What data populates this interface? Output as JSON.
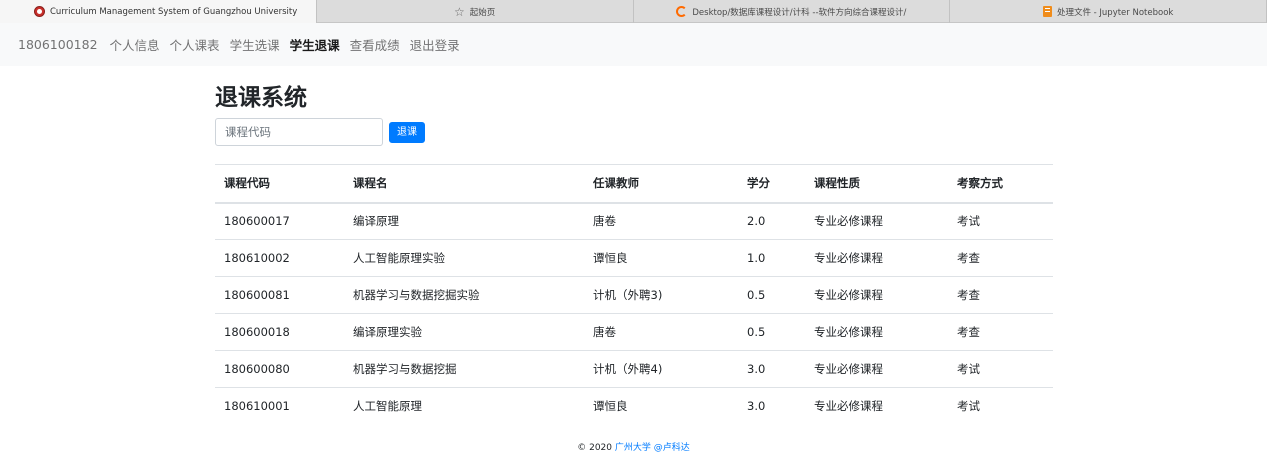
{
  "browser": {
    "tabs": [
      {
        "title": "Curriculum Management System of Guangzhou University",
        "icon": "gzhu-logo-icon",
        "active": true
      },
      {
        "title": "起始页",
        "icon": "star-icon",
        "active": false
      },
      {
        "title": "Desktop/数据库课程设计/计科 --软件方向综合课程设计/",
        "icon": "jupyter-loader-icon",
        "active": false
      },
      {
        "title": "处理文件 - Jupyter Notebook",
        "icon": "notebook-icon",
        "active": false
      }
    ]
  },
  "navbar": {
    "brand": "1806100182",
    "links": [
      {
        "label": "个人信息",
        "active": false
      },
      {
        "label": "个人课表",
        "active": false
      },
      {
        "label": "学生选课",
        "active": false
      },
      {
        "label": "学生退课",
        "active": true
      },
      {
        "label": "查看成绩",
        "active": false
      },
      {
        "label": "退出登录",
        "active": false
      }
    ]
  },
  "page": {
    "title": "退课系统",
    "input_placeholder": "课程代码",
    "input_value": "",
    "drop_button": "退课"
  },
  "table": {
    "headers": [
      "课程代码",
      "课程名",
      "任课教师",
      "学分",
      "课程性质",
      "考察方式"
    ],
    "rows": [
      [
        "180600017",
        "编译原理",
        "唐卷",
        "2.0",
        "专业必修课程",
        "考试"
      ],
      [
        "180610002",
        "人工智能原理实验",
        "谭恒良",
        "1.0",
        "专业必修课程",
        "考查"
      ],
      [
        "180600081",
        "机器学习与数据挖掘实验",
        "计机（外聘3)",
        "0.5",
        "专业必修课程",
        "考查"
      ],
      [
        "180600018",
        "编译原理实验",
        "唐卷",
        "0.5",
        "专业必修课程",
        "考查"
      ],
      [
        "180600080",
        "机器学习与数据挖掘",
        "计机（外聘4)",
        "3.0",
        "专业必修课程",
        "考试"
      ],
      [
        "180610001",
        "人工智能原理",
        "谭恒良",
        "3.0",
        "专业必修课程",
        "考试"
      ]
    ]
  },
  "footer": {
    "copyright": "© 2020",
    "link_text": "广州大学 @卢科达"
  },
  "colors": {
    "primary": "#007bff",
    "navbar_bg": "#f8f9fa",
    "border": "#dee2e6"
  }
}
